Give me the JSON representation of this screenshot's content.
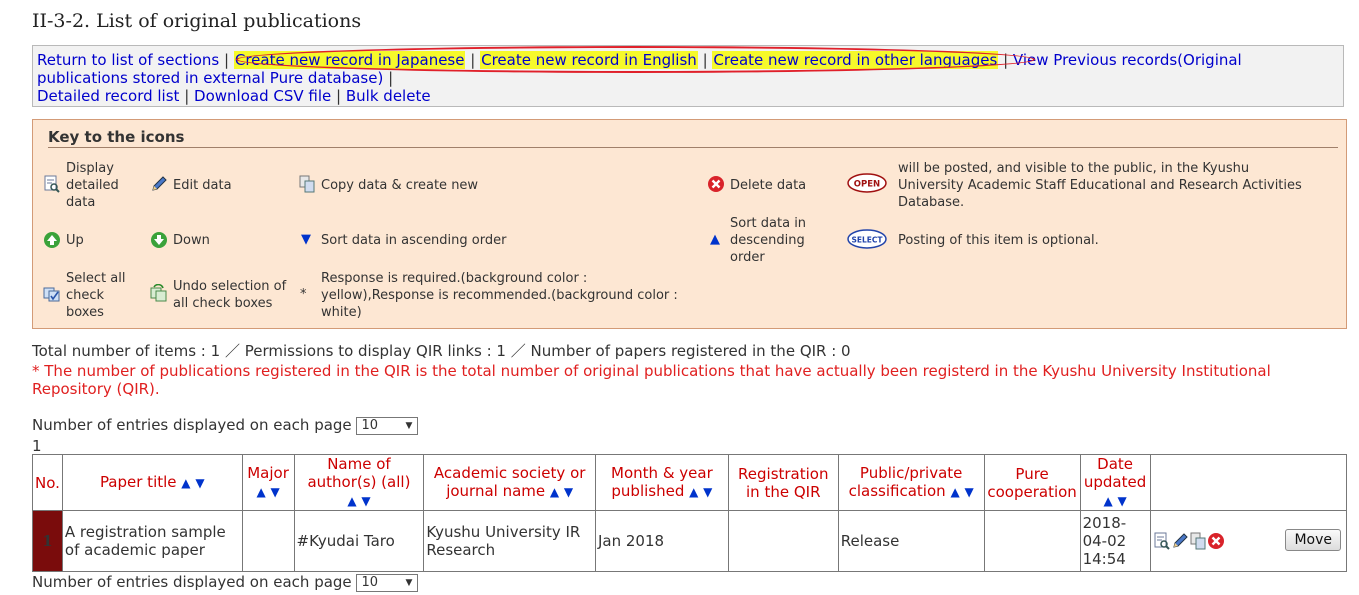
{
  "page_title": "II-3-2. List of original publications",
  "nav": {
    "return_link": "Return to list of sections",
    "create_japanese": "Create new record in Japanese",
    "create_english": "Create new record in English",
    "create_other": "Create new record in other languages",
    "view_previous_1": "View Previous records(Original",
    "view_previous_2": "publications stored in external Pure database)",
    "detailed_list": "Detailed record list",
    "download_csv": "Download CSV file",
    "bulk_delete": "Bulk delete",
    "sep": "|"
  },
  "key": {
    "title": "Key to the icons",
    "display_detailed_1": "Display",
    "display_detailed_2": "detailed",
    "display_detailed_3": "data",
    "edit": "Edit data",
    "copy": "Copy data & create new",
    "delete": "Delete data",
    "open_badge": "OPEN",
    "open_desc_1": "will be posted, and visible to the public, in the Kyushu",
    "open_desc_2": "University Academic Staff Educational and Research Activities",
    "open_desc_3": "Database.",
    "up": "Up",
    "down": "Down",
    "sort_asc": "Sort data in ascending order",
    "sort_desc_1": "Sort data in",
    "sort_desc_2": "descending",
    "sort_desc_3": "order",
    "select_badge": "SELECT",
    "select_desc": "Posting of this item is optional.",
    "select_all_1": "Select all",
    "select_all_2": "check",
    "select_all_3": "boxes",
    "undo_1": "Undo selection of",
    "undo_2": "all check boxes",
    "asterisk": "*",
    "required_1": "Response is required.(background color :",
    "required_2": "yellow),Response is recommended.(background color :",
    "required_3": "white)"
  },
  "totals": "Total number of items : 1 ／ Permissions to display QIR links : 1 ／ Number of papers registered in the QIR : 0",
  "qir_note_1": "* The number of publications registered in the QIR is the total number of original publications that have actually been registerd in the Kyushu University Institutional",
  "qir_note_2": "Repository (QIR).",
  "per_page_label": "Number of entries displayed on each page",
  "per_page_value": "10",
  "page_number": "1",
  "table": {
    "headers": {
      "no": "No.",
      "paper_title": "Paper title",
      "major": "Major",
      "authors_1": "Name of",
      "authors_2": "author(s) (all)",
      "journal_1": "Academic society or",
      "journal_2": "journal name",
      "month_1": "Month & year",
      "month_2": "published",
      "qir_1": "Registration",
      "qir_2": "in the QIR",
      "public_1": "Public/private",
      "public_2": "classification",
      "pure_1": "Pure",
      "pure_2": "cooperation",
      "date_1": "Date",
      "date_2": "updated"
    },
    "rows": [
      {
        "no": "1",
        "title_1": "A registration sample",
        "title_2": "of academic paper",
        "major": "",
        "authors": "#Kyudai Taro",
        "journal_1": "Kyushu University IR",
        "journal_2": "Research",
        "month": "Jan 2018",
        "qir": "",
        "public": "Release",
        "pure": "",
        "date_1": "2018-",
        "date_2": "04-02",
        "date_3": "14:54",
        "move": "Move"
      }
    ]
  },
  "sort_up": "▲",
  "sort_down": "▼",
  "colors": {
    "link": "#0000cc",
    "highlight": "#f6f92a",
    "oval": "#e0202a",
    "key_bg": "#fde7d3",
    "header_text": "#cc0000",
    "row_number_bg": "#7a0c0c",
    "note_red": "#e02020"
  }
}
